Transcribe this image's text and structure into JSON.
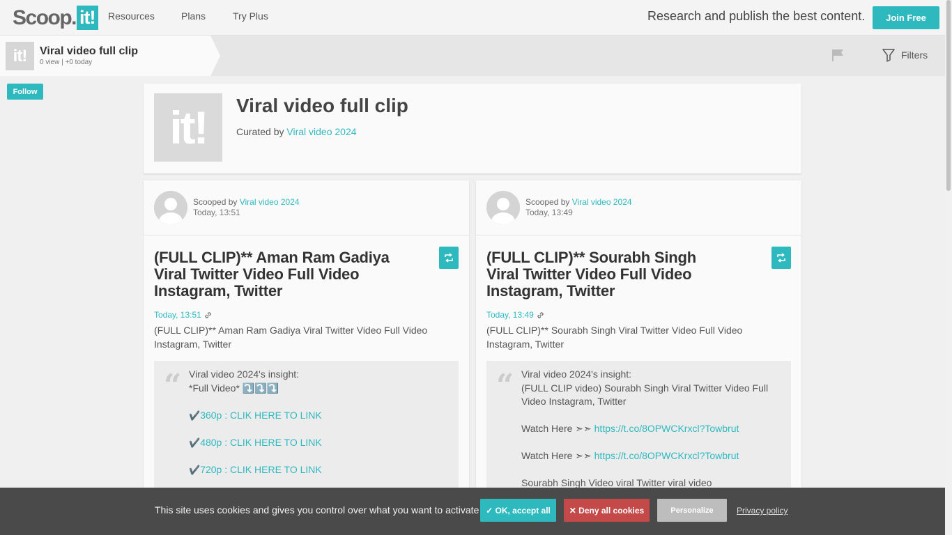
{
  "nav": {
    "logo_text": "Scoop.",
    "logo_box": "it!",
    "links": [
      "Resources",
      "Plans",
      "Try Plus"
    ],
    "tagline": "Research and publish the best content.",
    "join_label": "Join Free"
  },
  "topic_bar": {
    "thumb": "it!",
    "title": "Viral video full clip",
    "stats": "0 view | +0 today",
    "filters_label": "Filters",
    "follow_label": "Follow"
  },
  "header": {
    "thumb": "it!",
    "title": "Viral video full clip",
    "curated_prefix": "Curated by ",
    "curator": "Viral video 2024"
  },
  "posts": [
    {
      "scooped_prefix": "Scooped by ",
      "author": "Viral video 2024",
      "scooped_time": "Today, 13:51",
      "title": "(FULL CLIP)** Aman Ram Gadiya Viral Twitter Video Full Video Instagram, Twitter",
      "date": "Today, 13:51",
      "description": "(FULL CLIP)** Aman Ram Gadiya Viral Twitter Video Full Video Instagram, Twitter",
      "insight_label": "Viral video 2024's insight:",
      "insight_lines": [
        {
          "text": "*Full Video* ⤵️⤵️⤵️"
        },
        {
          "text": ""
        },
        {
          "check": "✔️",
          "link": "360p : CLIK HERE TO LINK"
        },
        {
          "text": ""
        },
        {
          "check": "✔️",
          "link": "480p : CLIK HERE TO LINK"
        },
        {
          "text": ""
        },
        {
          "check": "✔️",
          "link": "720p : CLIK HERE TO LINK"
        }
      ]
    },
    {
      "scooped_prefix": "Scooped by ",
      "author": "Viral video 2024",
      "scooped_time": "Today, 13:49",
      "title": "(FULL CLIP)** Sourabh Singh Viral Twitter Video Full Video Instagram, Twitter",
      "date": "Today, 13:49",
      "description": "(FULL CLIP)** Sourabh Singh Viral Twitter Video Full Video Instagram, Twitter",
      "insight_label": "Viral video 2024's insight:",
      "insight_lines": [
        {
          "text": "(FULL CLIP video) Sourabh Singh Viral Twitter Video Full Video Instagram, Twitter",
          "wrap": true
        },
        {
          "text": ""
        },
        {
          "prefix": "Watch Here ➣➣ ",
          "link": "https://t.co/8OPWCKrxcl?Towbrut"
        },
        {
          "text": ""
        },
        {
          "prefix": "Watch Here ➣➣ ",
          "link": "https://t.co/8OPWCKrxcl?Towbrut"
        },
        {
          "text": ""
        },
        {
          "text": "Sourabh Singh Video viral Twitter viral video"
        }
      ]
    }
  ],
  "cookie": {
    "text": "This site uses cookies and gives you control over what you want to activate",
    "ok_label": "✓ OK, accept all",
    "deny_label": "✕ Deny all cookies",
    "personalize_label": "Personalize",
    "privacy_label": "Privacy policy"
  },
  "colors": {
    "accent": "#2eb9bf",
    "deny": "#c44a4a",
    "cookie_bg": "#4a4a4a"
  }
}
